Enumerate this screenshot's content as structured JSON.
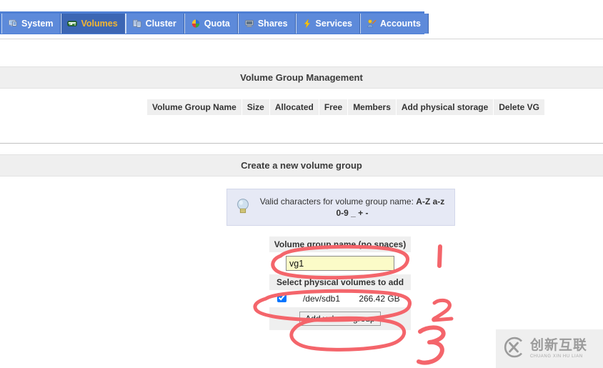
{
  "nav": {
    "tabs": [
      {
        "label": "System",
        "icon": "monitor-icon",
        "active": false
      },
      {
        "label": "Volumes",
        "icon": "drive-icon",
        "active": true
      },
      {
        "label": "Cluster",
        "icon": "cluster-icon",
        "active": false
      },
      {
        "label": "Quota",
        "icon": "quota-icon",
        "active": false
      },
      {
        "label": "Shares",
        "icon": "shares-icon",
        "active": false
      },
      {
        "label": "Services",
        "icon": "lightning-icon",
        "active": false
      },
      {
        "label": "Accounts",
        "icon": "accounts-icon",
        "active": false
      }
    ]
  },
  "vg_management": {
    "title": "Volume Group Management",
    "columns": [
      "Volume Group Name",
      "Size",
      "Allocated",
      "Free",
      "Members",
      "Add physical storage",
      "Delete VG"
    ],
    "rows": []
  },
  "create_vg": {
    "title": "Create a new volume group",
    "hint": {
      "icon": "lightbulb-icon",
      "line1_prefix": "Valid characters for volume group name: ",
      "line1_bold": "A-Z a-z",
      "line2_bold": "0-9 _ + -"
    },
    "name_field": {
      "label": "Volume group name (no spaces)",
      "value": "vg1",
      "placeholder": ""
    },
    "pv_section": {
      "label": "Select physical volumes to add",
      "rows": [
        {
          "checked": true,
          "device": "/dev/sdb1",
          "size": "266.42 GB"
        }
      ]
    },
    "submit_label": "Add volume group"
  },
  "annotations": {
    "marker_color": "#f4656b",
    "numbers": [
      "1",
      "2",
      "3"
    ]
  },
  "watermark": {
    "logo": "cx-logo-icon",
    "chinese": "创新互联",
    "pinyin": "CHUANG XIN HU LIAN"
  },
  "colors": {
    "tabbar_bg": "#4e7fd4",
    "tab_bg": "#5d8ada",
    "tab_active_bg": "#3c66b4",
    "tab_active_text": "#f5b731",
    "band_bg": "#efefef",
    "hint_bg": "#e6e9f5",
    "input_bg": "#fbfbc8",
    "annotation": "#f4656b"
  }
}
